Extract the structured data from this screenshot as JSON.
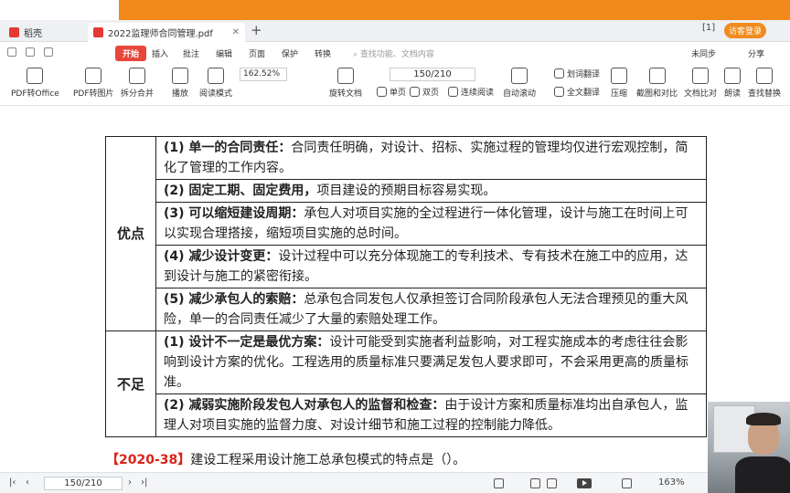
{
  "window": {
    "tabs": [
      {
        "label": "稻壳",
        "icon": "docer-icon",
        "color": "#e53935"
      },
      {
        "label": "2022监理师合同管理.pdf",
        "icon": "pdf-file-icon",
        "color": "#e53935"
      }
    ],
    "page_indicator": "1",
    "login_label": "访客登录"
  },
  "menu": {
    "items": [
      "开始",
      "插入",
      "批注",
      "编辑",
      "页面",
      "保护",
      "转换"
    ],
    "search_placeholder": "查找功能、文档内容",
    "right": [
      "未同步",
      "分享"
    ]
  },
  "ribbon": {
    "zoom": "162.52%",
    "page": "150/210",
    "tools": [
      {
        "label": "PDF转Office",
        "icon": "pdf-to-office-icon"
      },
      {
        "label": "PDF转图片",
        "icon": "pdf-to-image-icon"
      },
      {
        "label": "拆分合并",
        "icon": "split-merge-icon"
      },
      {
        "label": "播放",
        "icon": "play-icon"
      },
      {
        "label": "阅读模式",
        "icon": "read-mode-icon"
      },
      {
        "label": "旋转文档",
        "icon": "rotate-icon"
      },
      {
        "label": "自动滚动",
        "icon": "auto-scroll-icon"
      },
      {
        "label": "压缩",
        "icon": "compress-icon"
      },
      {
        "label": "截图和对比",
        "icon": "screenshot-icon"
      },
      {
        "label": "文档比对",
        "icon": "compare-icon"
      },
      {
        "label": "朗读",
        "icon": "read-aloud-icon"
      },
      {
        "label": "查找替换",
        "icon": "find-replace-icon"
      }
    ],
    "view_modes": [
      "单页",
      "双页",
      "连续阅读"
    ],
    "translate": [
      "划词翻译",
      "全文翻译"
    ]
  },
  "document": {
    "rows": [
      {
        "side": "优点",
        "items": [
          {
            "bold": "(1) 单一的合同责任：",
            "text": "合同责任明确，对设计、招标、实施过程的管理均仅进行宏观控制，简化了管理的工作内容。"
          },
          {
            "bold": "(2) 固定工期、固定费用，",
            "text": "项目建设的预期目标容易实现。"
          },
          {
            "bold": "(3) 可以缩短建设周期：",
            "text": "承包人对项目实施的全过程进行一体化管理，设计与施工在时间上可以实现合理搭接，缩短项目实施的总时间。"
          },
          {
            "bold": "(4) 减少设计变更：",
            "text": "设计过程中可以充分体现施工的专利技术、专有技术在施工中的应用，达到设计与施工的紧密衔接。"
          },
          {
            "bold": "(5) 减少承包人的索赔：",
            "text": "总承包合同发包人仅承担签订合同阶段承包人无法合理预见的重大风险，单一的合同责任减少了大量的索赔处理工作。"
          }
        ]
      },
      {
        "side": "不足",
        "items": [
          {
            "bold": "(1) 设计不一定是最优方案：",
            "text": "设计可能受到实施者利益影响，对工程实施成本的考虑往往会影响到设计方案的优化。工程选用的质量标准只要满足发包人要求即可，不会采用更高的质量标准。"
          },
          {
            "bold": "(2) 减弱实施阶段发包人对承包人的监督和检查：",
            "text": "由于设计方案和质量标准均出自承包人，监理人对项目实施的监督力度、对设计细节和施工过程的控制能力降低。"
          }
        ]
      }
    ],
    "question_tag": "【2020-38】",
    "question_text": "建设工程采用设计施工总承包模式的特点是（）。"
  },
  "statusbar": {
    "page": "150/210",
    "zoom": "163%"
  }
}
